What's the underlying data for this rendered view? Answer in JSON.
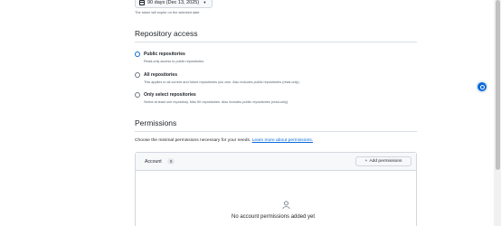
{
  "expiration": {
    "button_label": "90 days (Dec 13, 2025)",
    "hint": "The token will expire on the selected date"
  },
  "repository_access": {
    "title": "Repository access",
    "options": [
      {
        "label": "Public repositories",
        "description": "Read-only access to public repositories.",
        "selected": true
      },
      {
        "label": "All repositories",
        "description": "This applies to all current and future repositories you own. Also includes public repositories (read-only).",
        "selected": false
      },
      {
        "label": "Only select repositories",
        "description": "Select at least one repository. Max 50 repositories. Also includes public repositories (read-only).",
        "selected": false
      }
    ]
  },
  "permissions": {
    "title": "Permissions",
    "description": "Choose the minimal permissions necessary for your needs.",
    "learn_more_link": "Learn more about permissions.",
    "panel": {
      "title": "Account",
      "count": "0",
      "add_button": "Add permissions",
      "empty_message": "No account permissions added yet"
    }
  },
  "icons": {
    "calendar": "calendar-icon",
    "caret": "triangle-down-icon",
    "plus": "plus-icon",
    "person": "person-icon",
    "floating_badge": "extension-badge-icon"
  },
  "colors": {
    "accent": "#0969da",
    "border": "#d0d7de",
    "muted_text": "#59636e"
  }
}
